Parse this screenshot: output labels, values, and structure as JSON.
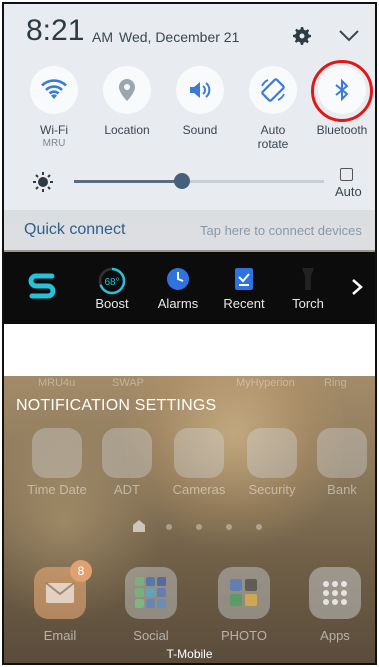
{
  "status": {
    "time": "8:21",
    "ampm": "AM",
    "date": "Wed, December 21"
  },
  "quick_settings": [
    {
      "label": "Wi-Fi",
      "sublabel": "MRU",
      "icon": "wifi-icon"
    },
    {
      "label": "Location",
      "icon": "location-icon"
    },
    {
      "label": "Sound",
      "icon": "sound-icon"
    },
    {
      "label": "Auto\nrotate",
      "icon": "auto-rotate-icon"
    },
    {
      "label": "Bluetooth",
      "icon": "bluetooth-icon"
    }
  ],
  "brightness": {
    "level": 0.43,
    "auto_label": "Auto"
  },
  "quick_connect": {
    "title": "Quick connect",
    "hint": "Tap here to connect devices"
  },
  "widget": {
    "boost_value": "68°",
    "items": [
      "Boost",
      "Alarms",
      "Recent",
      "Torch"
    ]
  },
  "home": {
    "under_labels": [
      "MRU4u",
      "SWAP",
      "MyHyperion",
      "Ring"
    ],
    "notification_settings": "NOTIFICATION SETTINGS",
    "row1": [
      "Time Date",
      "ADT",
      "Cameras",
      "Security",
      "Bank"
    ],
    "dock": [
      "Email",
      "Social",
      "PHOTO",
      "Apps"
    ],
    "email_badge": "8",
    "carrier": "T-Mobile"
  },
  "colors": {
    "accent": "#2f5f8a",
    "ring": "#e01818",
    "bluetooth": "#3a7bd5"
  }
}
